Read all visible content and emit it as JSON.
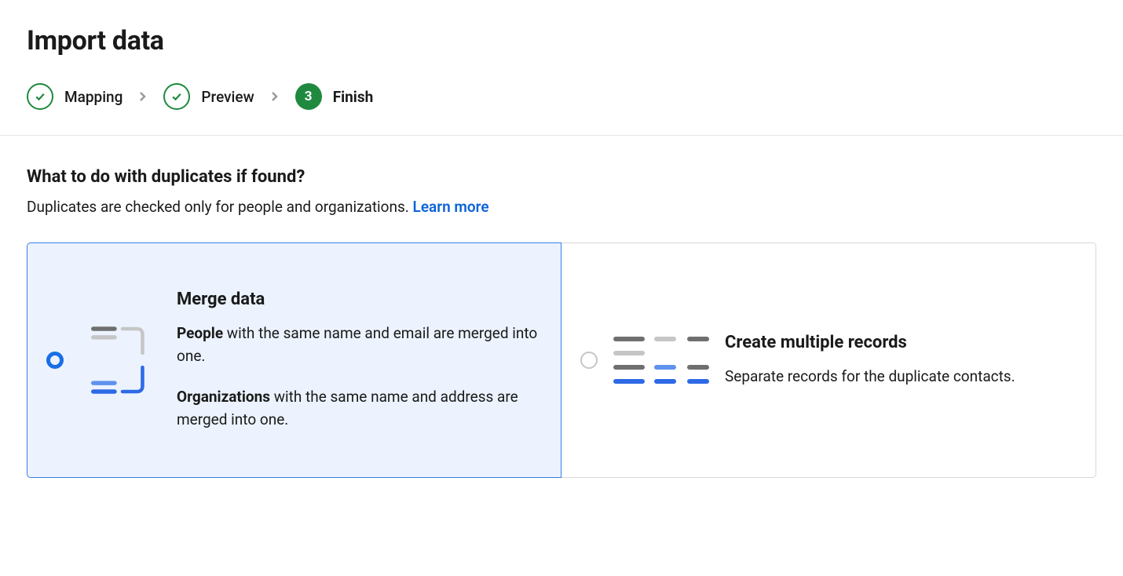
{
  "page": {
    "title": "Import data"
  },
  "stepper": {
    "steps": [
      {
        "label": "Mapping",
        "state": "done"
      },
      {
        "label": "Preview",
        "state": "done"
      },
      {
        "label": "Finish",
        "state": "current",
        "number": "3"
      }
    ]
  },
  "duplicates": {
    "heading": "What to do with duplicates if found?",
    "subtext_prefix": "Duplicates are checked only for people and organizations. ",
    "learn_more_label": "Learn more",
    "options": {
      "merge": {
        "title": "Merge data",
        "people_bold": "People",
        "people_rest": " with the same name and email are merged into one.",
        "orgs_bold": "Organizations",
        "orgs_rest": " with the same name and address are merged into one.",
        "selected": true
      },
      "create_multiple": {
        "title": "Create multiple records",
        "body": "Separate records for the duplicate contacts.",
        "selected": false
      }
    }
  }
}
